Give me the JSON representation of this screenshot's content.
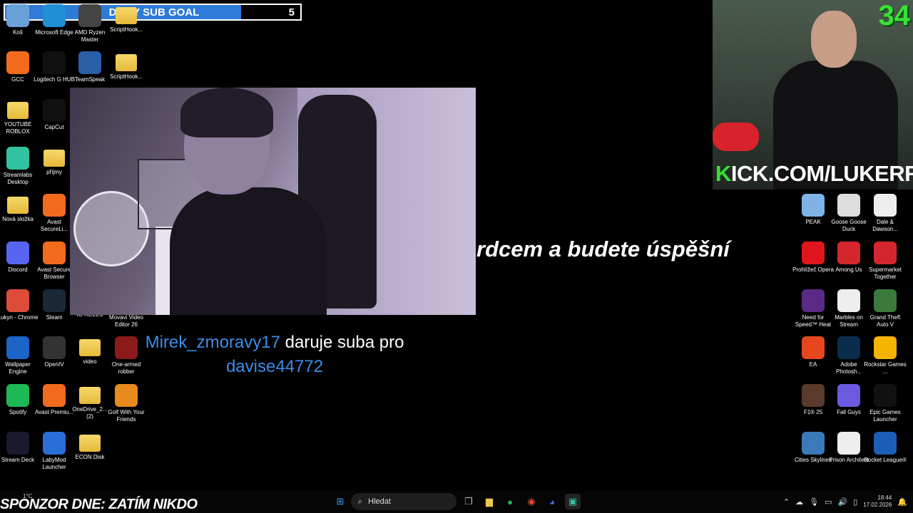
{
  "subgoal": {
    "current": "5",
    "label": "DAILY SUB GOAL",
    "target": "5",
    "progress_fraction": 0.8
  },
  "desktop_left": [
    {
      "label": "Koš",
      "icon": "recycle-bin-icon",
      "color": "#6aa0d8"
    },
    {
      "label": "Microsoft Edge",
      "icon": "edge-icon",
      "color": "#1f8fd6"
    },
    {
      "label": "AMD Ryzen Master",
      "icon": "amd-icon",
      "color": "#444"
    },
    {
      "label": "ScriptHook...",
      "icon": "folder-icon",
      "color": "#f0c64a"
    },
    {
      "label": "GCC",
      "icon": "gcc-icon",
      "color": "#f26b1d"
    },
    {
      "label": "Logitech G HUB",
      "icon": "logitech-icon",
      "color": "#111"
    },
    {
      "label": "TeamSpeak",
      "icon": "teamspeak-icon",
      "color": "#2a5fa8"
    },
    {
      "label": "ScriptHook...",
      "icon": "folder-icon",
      "color": "#f0c64a"
    },
    {
      "label": "YOUTUBE ROBLOX",
      "icon": "folder-icon",
      "color": "#f0c64a"
    },
    {
      "label": "CapCut",
      "icon": "capcut-icon",
      "color": "#111"
    },
    {
      "label": "Streamlabs Desktop",
      "icon": "streamlabs-icon",
      "color": "#31c3a2"
    },
    {
      "label": "příjmy",
      "icon": "folder-icon",
      "color": "#f0c64a"
    },
    {
      "label": "Nová složka",
      "icon": "folder-icon",
      "color": "#f0c64a"
    },
    {
      "label": "Avast SecureLi...",
      "icon": "avast-secureline-icon",
      "color": "#f26b1d"
    },
    {
      "label": "Discord",
      "icon": "discord-icon",
      "color": "#5865f2"
    },
    {
      "label": "Avast Secure Browser",
      "icon": "avast-browser-icon",
      "color": "#f26b1d"
    },
    {
      "label": "Lukyn - Chrome",
      "icon": "chrome-icon",
      "color": "#dd4b39"
    },
    {
      "label": "Steam",
      "icon": "steam-icon",
      "color": "#1b2838"
    },
    {
      "label": "IG REELS",
      "icon": "folder-icon",
      "color": "#f0c64a"
    },
    {
      "label": "Movavi Video Editor 26",
      "icon": "movavi-icon",
      "color": "#2d9cdb"
    },
    {
      "label": "Wallpaper Engine",
      "icon": "wallpaper-engine-icon",
      "color": "#1c64c8"
    },
    {
      "label": "OpenIV",
      "icon": "openiv-icon",
      "color": "#333"
    },
    {
      "label": "video",
      "icon": "folder-icon",
      "color": "#f0c64a"
    },
    {
      "label": "One-armed robber",
      "icon": "one-armed-robber-icon",
      "color": "#8b1b1b"
    },
    {
      "label": "Spotify",
      "icon": "spotify-icon",
      "color": "#1db954"
    },
    {
      "label": "Avast Premiu...",
      "icon": "avast-premium-icon",
      "color": "#f26b1d"
    },
    {
      "label": "OneDrive_2... (2)",
      "icon": "folder-icon",
      "color": "#f0c64a"
    },
    {
      "label": "Golf With Your Friends",
      "icon": "golf-icon",
      "color": "#e88b1d"
    },
    {
      "label": "Stream Deck",
      "icon": "stream-deck-icon",
      "color": "#1a1a2e"
    },
    {
      "label": "LabyMod Launcher",
      "icon": "labymod-icon",
      "color": "#2a6fd6"
    },
    {
      "label": "ECON Disk",
      "icon": "folder-icon",
      "color": "#f0c64a"
    }
  ],
  "desktop_right": [
    {
      "label": "PEAK",
      "icon": "peak-icon",
      "color": "#7fb3e8"
    },
    {
      "label": "Goose Goose Duck",
      "icon": "goose-icon",
      "color": "#ddd"
    },
    {
      "label": "Dale & Dawson...",
      "icon": "dale-dawson-icon",
      "color": "#eee"
    },
    {
      "label": "Prohlížeč Opera",
      "icon": "opera-icon",
      "color": "#e0161e"
    },
    {
      "label": "Among Us",
      "icon": "among-us-icon",
      "color": "#d6262d"
    },
    {
      "label": "Supermarket Together",
      "icon": "supermarket-icon",
      "color": "#d6262d"
    },
    {
      "label": "Need for Speed™ Heat",
      "icon": "nfs-icon",
      "color": "#5b2a86"
    },
    {
      "label": "Marbles on Stream",
      "icon": "marbles-icon",
      "color": "#eee"
    },
    {
      "label": "Grand Theft Auto V",
      "icon": "gta-icon",
      "color": "#3a7a3a"
    },
    {
      "label": "EA",
      "icon": "ea-icon",
      "color": "#e8461f"
    },
    {
      "label": "Adobe Photosh...",
      "icon": "photoshop-icon",
      "color": "#0b2d4d"
    },
    {
      "label": "Rockstar Games ...",
      "icon": "rockstar-icon",
      "color": "#f4b400"
    },
    {
      "label": "F1® 25",
      "icon": "f1-icon",
      "color": "#5a3a2a"
    },
    {
      "label": "Fall Guys",
      "icon": "fall-guys-icon",
      "color": "#6a5ae0"
    },
    {
      "label": "Epic Games Launcher",
      "icon": "epic-games-icon",
      "color": "#111"
    },
    {
      "label": "Cities Skylines",
      "icon": "cities-icon",
      "color": "#3a7ab8"
    },
    {
      "label": "Prison Architect",
      "icon": "prison-architect-icon",
      "color": "#eee"
    },
    {
      "label": "Rocket League®",
      "icon": "rocket-league-icon",
      "color": "#1c5fb8"
    }
  ],
  "slogan": "rdcem a budete úspěšní",
  "sub_alert": {
    "user": "Mirek_zmoravy17",
    "text": "daruje suba pro",
    "recipient": "davise44772"
  },
  "cam": {
    "count": "34",
    "kick_prefix": "K",
    "kick_rest": "ICK.COM/LUKERRIS"
  },
  "sponsor": "SPONZOR DNE: ZATÍM NIKDO",
  "taskbar": {
    "weather": "1°C",
    "search_placeholder": "Hledat",
    "time": "18:44",
    "date": "17.02.2026"
  }
}
